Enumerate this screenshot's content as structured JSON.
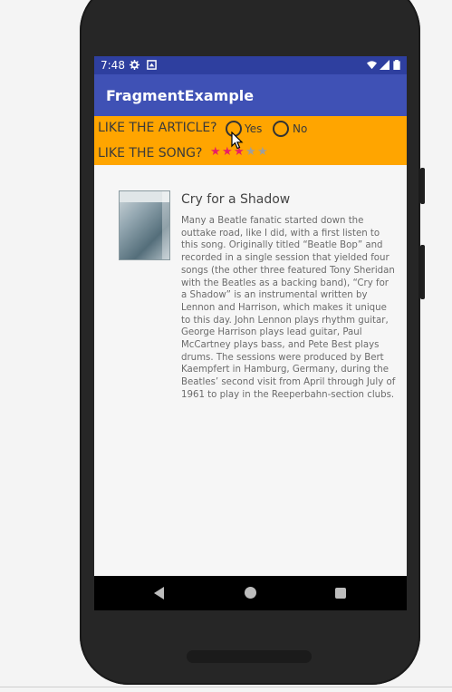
{
  "status_bar": {
    "time": "7:48",
    "icons": [
      "settings-icon",
      "notification-icon",
      "wifi-icon",
      "signal-icon",
      "battery-icon"
    ]
  },
  "app_bar": {
    "title": "FragmentExample"
  },
  "feedback": {
    "article_question": "LIKE THE ARTICLE?",
    "options": [
      "Yes",
      "No"
    ],
    "song_question": "LIKE THE SONG?",
    "rating": 3,
    "rating_max": 5
  },
  "article": {
    "title": "Cry for a Shadow",
    "body": "Many a Beatle fanatic started down the outtake road, like I did, with a first listen to this song. Originally titled “Beatle Bop” and recorded in a single session that yielded four songs (the other three featured Tony Sheridan with the Beatles as a backing band), “Cry for a Shadow” is an instrumental written by Lennon and Harrison, which makes it unique to this day. John Lennon plays rhythm guitar, George Harrison plays lead guitar, Paul McCartney plays bass, and Pete Best plays drums. The sessions were produced by Bert Kaempfert in Hamburg, Germany, during the Beatles’ second visit from April through July of 1961 to play in the Reeperbahn-section clubs."
  },
  "colors": {
    "primary": "#3f51b5",
    "primary_dark": "#2e3f9f",
    "accent_bar": "#ffa500",
    "star_filled": "#e91e63",
    "star_empty": "#9e9e9e"
  }
}
